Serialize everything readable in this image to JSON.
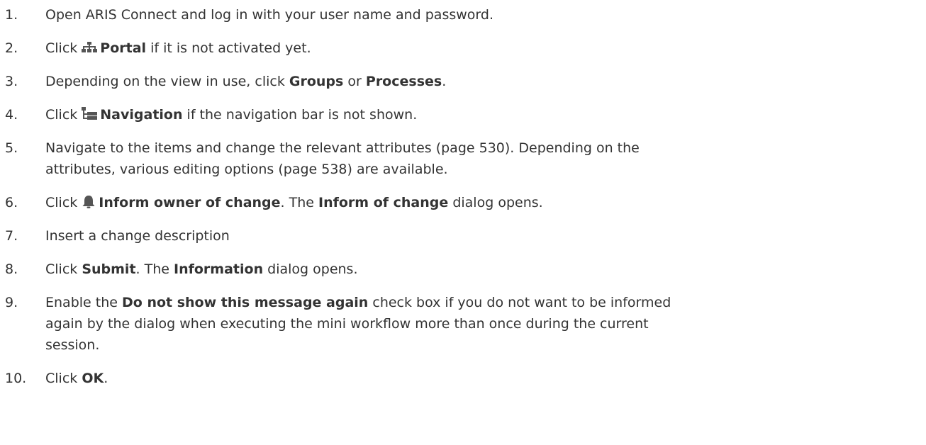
{
  "steps": [
    {
      "number": "1.",
      "text": "Open ARIS Connect and log in with your user name and password."
    },
    {
      "number": "2.",
      "before": "Click",
      "icon": "portal-icon",
      "bold": "Portal",
      "after": "if it is not activated yet."
    },
    {
      "number": "3.",
      "before": "Depending on the view in use, click",
      "bold1": "Groups",
      "middle": "or",
      "bold2": "Processes",
      "after": "."
    },
    {
      "number": "4.",
      "before": "Click",
      "icon": "navigation-icon",
      "bold": "Navigation",
      "after": "if the navigation bar is not shown."
    },
    {
      "number": "5.",
      "line1": "Navigate to the items and change the relevant attributes (page 530). Depending on the",
      "line2": "attributes, various editing options (page 538) are available."
    },
    {
      "number": "6.",
      "before": "Click",
      "icon": "bell-icon",
      "bold1": "Inform owner of change",
      "middle": ". The",
      "bold2": "Inform of change",
      "after": "dialog opens."
    },
    {
      "number": "7.",
      "text": "Insert a change description"
    },
    {
      "number": "8.",
      "before": "Click",
      "bold1": "Submit",
      "middle": ". The",
      "bold2": "Information",
      "after": "dialog opens."
    },
    {
      "number": "9.",
      "before": "Enable the",
      "bold": "Do not show this message again",
      "line1_after": "check box if you do not want to be informed",
      "line2": "again by the dialog when executing the mini workflow more than once during the current",
      "line3": "session."
    },
    {
      "number": "10.",
      "before": "Click",
      "bold": "OK",
      "after": "."
    }
  ]
}
